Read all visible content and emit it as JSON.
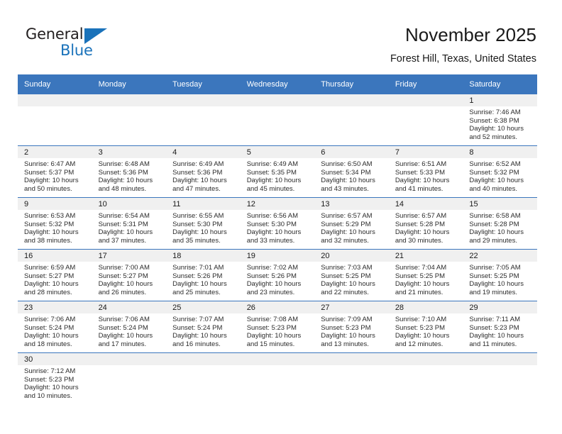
{
  "logo": {
    "word_top": "General",
    "word_bottom": "Blue",
    "flag_icon": "triangle-flag-icon",
    "accent_color": "#1a72ba"
  },
  "header": {
    "title": "November 2025",
    "subtitle": "Forest Hill, Texas, United States"
  },
  "theme": {
    "header_blue": "#3b76bd",
    "daynum_band": "#f0f0f0",
    "text": "#1a1a1a"
  },
  "calendar": {
    "weekday_headers": [
      "Sunday",
      "Monday",
      "Tuesday",
      "Wednesday",
      "Thursday",
      "Friday",
      "Saturday"
    ],
    "labels": {
      "sunrise": "Sunrise:",
      "sunset": "Sunset:",
      "daylight": "Daylight:"
    },
    "weeks": [
      [
        {
          "blank": true,
          "day": ""
        },
        {
          "blank": true,
          "day": ""
        },
        {
          "blank": true,
          "day": ""
        },
        {
          "blank": true,
          "day": ""
        },
        {
          "blank": true,
          "day": ""
        },
        {
          "blank": true,
          "day": ""
        },
        {
          "blank": false,
          "day": "1",
          "sunrise": "Sunrise: 7:46 AM",
          "sunset": "Sunset: 6:38 PM",
          "daylight_line1": "Daylight: 10 hours",
          "daylight_line2": "and 52 minutes."
        }
      ],
      [
        {
          "blank": false,
          "day": "2",
          "sunrise": "Sunrise: 6:47 AM",
          "sunset": "Sunset: 5:37 PM",
          "daylight_line1": "Daylight: 10 hours",
          "daylight_line2": "and 50 minutes."
        },
        {
          "blank": false,
          "day": "3",
          "sunrise": "Sunrise: 6:48 AM",
          "sunset": "Sunset: 5:36 PM",
          "daylight_line1": "Daylight: 10 hours",
          "daylight_line2": "and 48 minutes."
        },
        {
          "blank": false,
          "day": "4",
          "sunrise": "Sunrise: 6:49 AM",
          "sunset": "Sunset: 5:36 PM",
          "daylight_line1": "Daylight: 10 hours",
          "daylight_line2": "and 47 minutes."
        },
        {
          "blank": false,
          "day": "5",
          "sunrise": "Sunrise: 6:49 AM",
          "sunset": "Sunset: 5:35 PM",
          "daylight_line1": "Daylight: 10 hours",
          "daylight_line2": "and 45 minutes."
        },
        {
          "blank": false,
          "day": "6",
          "sunrise": "Sunrise: 6:50 AM",
          "sunset": "Sunset: 5:34 PM",
          "daylight_line1": "Daylight: 10 hours",
          "daylight_line2": "and 43 minutes."
        },
        {
          "blank": false,
          "day": "7",
          "sunrise": "Sunrise: 6:51 AM",
          "sunset": "Sunset: 5:33 PM",
          "daylight_line1": "Daylight: 10 hours",
          "daylight_line2": "and 41 minutes."
        },
        {
          "blank": false,
          "day": "8",
          "sunrise": "Sunrise: 6:52 AM",
          "sunset": "Sunset: 5:32 PM",
          "daylight_line1": "Daylight: 10 hours",
          "daylight_line2": "and 40 minutes."
        }
      ],
      [
        {
          "blank": false,
          "day": "9",
          "sunrise": "Sunrise: 6:53 AM",
          "sunset": "Sunset: 5:32 PM",
          "daylight_line1": "Daylight: 10 hours",
          "daylight_line2": "and 38 minutes."
        },
        {
          "blank": false,
          "day": "10",
          "sunrise": "Sunrise: 6:54 AM",
          "sunset": "Sunset: 5:31 PM",
          "daylight_line1": "Daylight: 10 hours",
          "daylight_line2": "and 37 minutes."
        },
        {
          "blank": false,
          "day": "11",
          "sunrise": "Sunrise: 6:55 AM",
          "sunset": "Sunset: 5:30 PM",
          "daylight_line1": "Daylight: 10 hours",
          "daylight_line2": "and 35 minutes."
        },
        {
          "blank": false,
          "day": "12",
          "sunrise": "Sunrise: 6:56 AM",
          "sunset": "Sunset: 5:30 PM",
          "daylight_line1": "Daylight: 10 hours",
          "daylight_line2": "and 33 minutes."
        },
        {
          "blank": false,
          "day": "13",
          "sunrise": "Sunrise: 6:57 AM",
          "sunset": "Sunset: 5:29 PM",
          "daylight_line1": "Daylight: 10 hours",
          "daylight_line2": "and 32 minutes."
        },
        {
          "blank": false,
          "day": "14",
          "sunrise": "Sunrise: 6:57 AM",
          "sunset": "Sunset: 5:28 PM",
          "daylight_line1": "Daylight: 10 hours",
          "daylight_line2": "and 30 minutes."
        },
        {
          "blank": false,
          "day": "15",
          "sunrise": "Sunrise: 6:58 AM",
          "sunset": "Sunset: 5:28 PM",
          "daylight_line1": "Daylight: 10 hours",
          "daylight_line2": "and 29 minutes."
        }
      ],
      [
        {
          "blank": false,
          "day": "16",
          "sunrise": "Sunrise: 6:59 AM",
          "sunset": "Sunset: 5:27 PM",
          "daylight_line1": "Daylight: 10 hours",
          "daylight_line2": "and 28 minutes."
        },
        {
          "blank": false,
          "day": "17",
          "sunrise": "Sunrise: 7:00 AM",
          "sunset": "Sunset: 5:27 PM",
          "daylight_line1": "Daylight: 10 hours",
          "daylight_line2": "and 26 minutes."
        },
        {
          "blank": false,
          "day": "18",
          "sunrise": "Sunrise: 7:01 AM",
          "sunset": "Sunset: 5:26 PM",
          "daylight_line1": "Daylight: 10 hours",
          "daylight_line2": "and 25 minutes."
        },
        {
          "blank": false,
          "day": "19",
          "sunrise": "Sunrise: 7:02 AM",
          "sunset": "Sunset: 5:26 PM",
          "daylight_line1": "Daylight: 10 hours",
          "daylight_line2": "and 23 minutes."
        },
        {
          "blank": false,
          "day": "20",
          "sunrise": "Sunrise: 7:03 AM",
          "sunset": "Sunset: 5:25 PM",
          "daylight_line1": "Daylight: 10 hours",
          "daylight_line2": "and 22 minutes."
        },
        {
          "blank": false,
          "day": "21",
          "sunrise": "Sunrise: 7:04 AM",
          "sunset": "Sunset: 5:25 PM",
          "daylight_line1": "Daylight: 10 hours",
          "daylight_line2": "and 21 minutes."
        },
        {
          "blank": false,
          "day": "22",
          "sunrise": "Sunrise: 7:05 AM",
          "sunset": "Sunset: 5:25 PM",
          "daylight_line1": "Daylight: 10 hours",
          "daylight_line2": "and 19 minutes."
        }
      ],
      [
        {
          "blank": false,
          "day": "23",
          "sunrise": "Sunrise: 7:06 AM",
          "sunset": "Sunset: 5:24 PM",
          "daylight_line1": "Daylight: 10 hours",
          "daylight_line2": "and 18 minutes."
        },
        {
          "blank": false,
          "day": "24",
          "sunrise": "Sunrise: 7:06 AM",
          "sunset": "Sunset: 5:24 PM",
          "daylight_line1": "Daylight: 10 hours",
          "daylight_line2": "and 17 minutes."
        },
        {
          "blank": false,
          "day": "25",
          "sunrise": "Sunrise: 7:07 AM",
          "sunset": "Sunset: 5:24 PM",
          "daylight_line1": "Daylight: 10 hours",
          "daylight_line2": "and 16 minutes."
        },
        {
          "blank": false,
          "day": "26",
          "sunrise": "Sunrise: 7:08 AM",
          "sunset": "Sunset: 5:23 PM",
          "daylight_line1": "Daylight: 10 hours",
          "daylight_line2": "and 15 minutes."
        },
        {
          "blank": false,
          "day": "27",
          "sunrise": "Sunrise: 7:09 AM",
          "sunset": "Sunset: 5:23 PM",
          "daylight_line1": "Daylight: 10 hours",
          "daylight_line2": "and 13 minutes."
        },
        {
          "blank": false,
          "day": "28",
          "sunrise": "Sunrise: 7:10 AM",
          "sunset": "Sunset: 5:23 PM",
          "daylight_line1": "Daylight: 10 hours",
          "daylight_line2": "and 12 minutes."
        },
        {
          "blank": false,
          "day": "29",
          "sunrise": "Sunrise: 7:11 AM",
          "sunset": "Sunset: 5:23 PM",
          "daylight_line1": "Daylight: 10 hours",
          "daylight_line2": "and 11 minutes."
        }
      ],
      [
        {
          "blank": false,
          "day": "30",
          "sunrise": "Sunrise: 7:12 AM",
          "sunset": "Sunset: 5:23 PM",
          "daylight_line1": "Daylight: 10 hours",
          "daylight_line2": "and 10 minutes."
        },
        {
          "blank": true,
          "day": ""
        },
        {
          "blank": true,
          "day": ""
        },
        {
          "blank": true,
          "day": ""
        },
        {
          "blank": true,
          "day": ""
        },
        {
          "blank": true,
          "day": ""
        },
        {
          "blank": true,
          "day": ""
        }
      ]
    ]
  }
}
